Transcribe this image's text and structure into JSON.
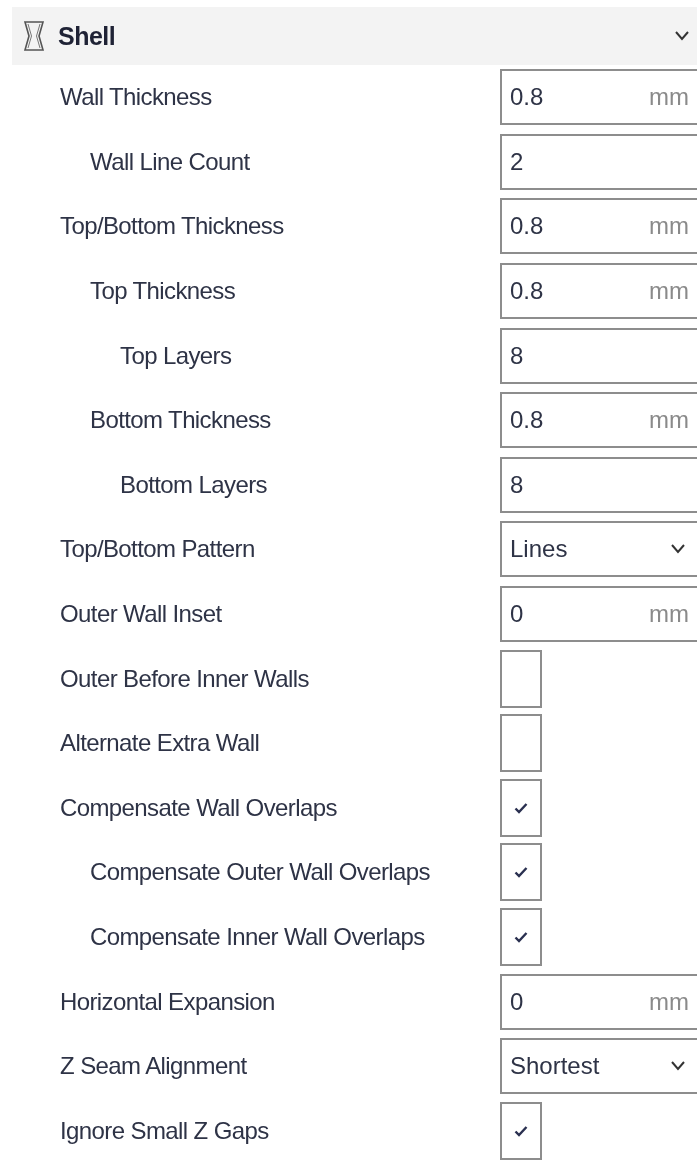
{
  "section": {
    "title": "Shell",
    "expanded": true
  },
  "settings": [
    {
      "label": "Wall Thickness",
      "kind": "number",
      "value": "0.8",
      "unit": "mm",
      "children": [
        {
          "label": "Wall Line Count",
          "kind": "number",
          "value": "2"
        }
      ]
    },
    {
      "label": "Top/Bottom Thickness",
      "kind": "number",
      "value": "0.8",
      "unit": "mm",
      "children": [
        {
          "label": "Top Thickness",
          "kind": "number",
          "value": "0.8",
          "unit": "mm",
          "children": [
            {
              "label": "Top Layers",
              "kind": "number",
              "value": "8"
            }
          ]
        },
        {
          "label": "Bottom Thickness",
          "kind": "number",
          "value": "0.8",
          "unit": "mm",
          "children": [
            {
              "label": "Bottom Layers",
              "kind": "number",
              "value": "8"
            }
          ]
        }
      ]
    },
    {
      "label": "Top/Bottom Pattern",
      "kind": "select",
      "value": "Lines"
    },
    {
      "label": "Outer Wall Inset",
      "kind": "number",
      "value": "0",
      "unit": "mm"
    },
    {
      "label": "Outer Before Inner Walls",
      "kind": "checkbox",
      "checked": false
    },
    {
      "label": "Alternate Extra Wall",
      "kind": "checkbox",
      "checked": false
    },
    {
      "label": "Compensate Wall Overlaps",
      "kind": "checkbox",
      "checked": true,
      "children": [
        {
          "label": "Compensate Outer Wall Overlaps",
          "kind": "checkbox",
          "checked": true
        },
        {
          "label": "Compensate Inner Wall Overlaps",
          "kind": "checkbox",
          "checked": true
        }
      ]
    },
    {
      "label": "Horizontal Expansion",
      "kind": "number",
      "value": "0",
      "unit": "mm"
    },
    {
      "label": "Z Seam Alignment",
      "kind": "select",
      "value": "Shortest"
    },
    {
      "label": "Ignore Small Z Gaps",
      "kind": "checkbox",
      "checked": true
    }
  ]
}
